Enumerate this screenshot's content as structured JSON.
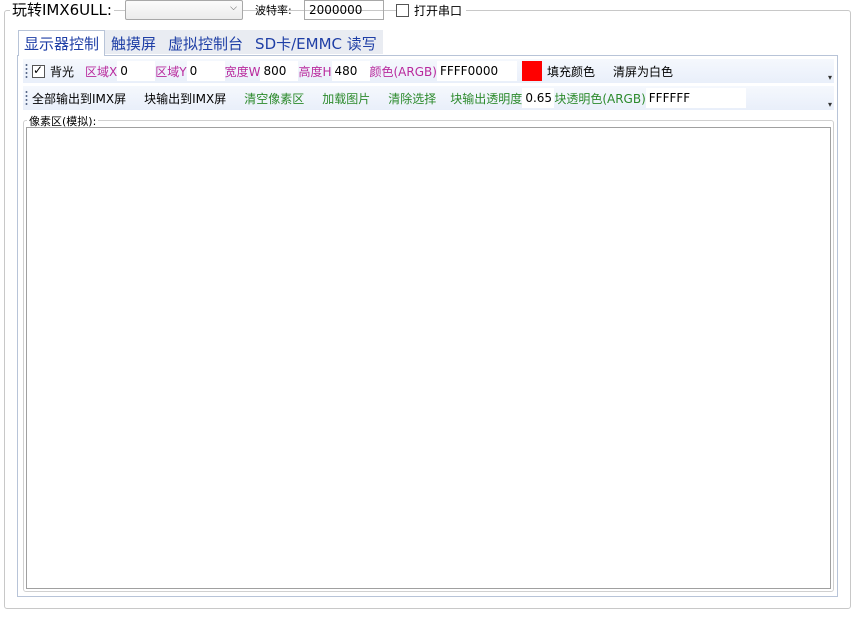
{
  "app": {
    "title": "玩转IMX6ULL:"
  },
  "serial": {
    "port_value": "",
    "baud_label": "波特率:",
    "baud_value": "2000000",
    "open_label": "打开串口",
    "open_checked": false
  },
  "tabs": [
    {
      "label": "显示器控制",
      "active": true
    },
    {
      "label": "触摸屏",
      "active": false
    },
    {
      "label": "虚拟控制台",
      "active": false
    },
    {
      "label": "SD卡/EMMC 读写",
      "active": false
    }
  ],
  "toolbar1": {
    "backlight_label": "背光",
    "backlight_checked": true,
    "region_x_label": "区域X",
    "region_x_value": "0",
    "region_y_label": "区域Y",
    "region_y_value": "0",
    "width_label": "宽度W",
    "width_value": "800",
    "height_label": "高度H",
    "height_value": "480",
    "color_label": "颜色(ARGB)",
    "color_value": "FFFF0000",
    "swatch_color": "#ff0000",
    "fill_label": "填充颜色",
    "clear_white_label": "清屏为白色"
  },
  "toolbar2": {
    "output_all_label": "全部输出到IMX屏",
    "output_block_label": "块输出到IMX屏",
    "clear_pixels_label": "清空像素区",
    "load_image_label": "加载图片",
    "clear_selection_label": "清除选择",
    "block_opacity_label": "块输出透明度",
    "block_opacity_value": "0.65",
    "block_transparent_color_label": "块透明色(ARGB)",
    "block_transparent_color_value": "FFFFFF"
  },
  "pixel_area": {
    "label": "像素区(模拟):"
  },
  "colors": {
    "pink": "#b92a9d",
    "green": "#2c8a2c",
    "tab_text": "#1f3fa6"
  }
}
